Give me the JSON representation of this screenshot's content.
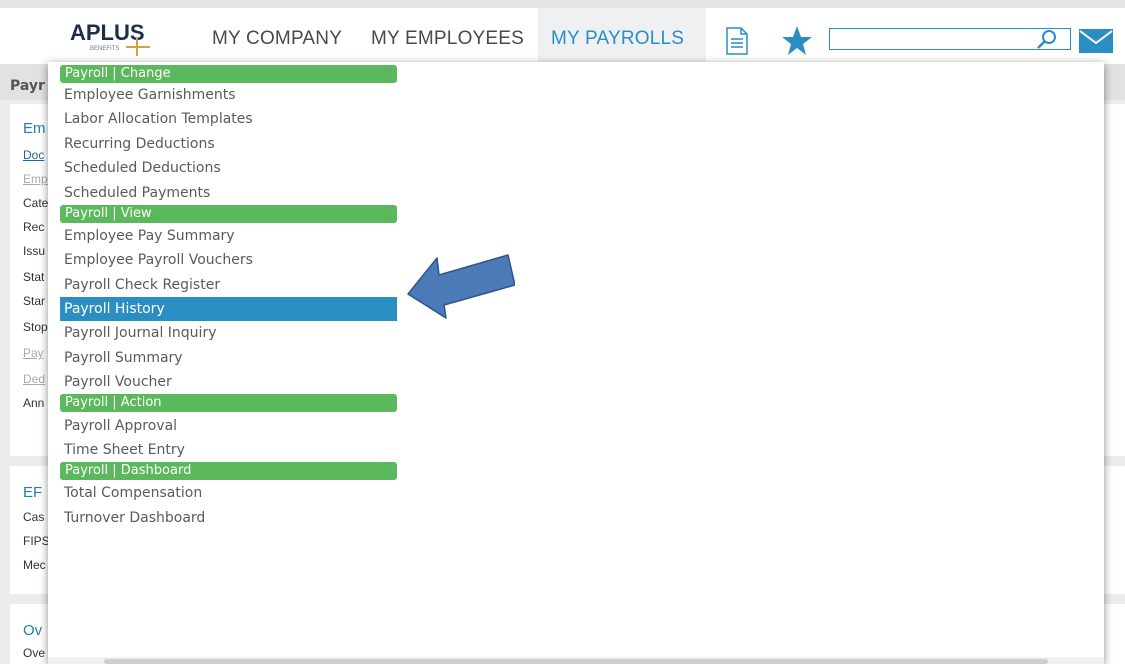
{
  "header": {
    "logo": {
      "main": "APLUS",
      "sub": "BENEFITS"
    },
    "nav": [
      {
        "label": "MY COMPANY",
        "active": false
      },
      {
        "label": "MY EMPLOYEES",
        "active": false
      },
      {
        "label": "MY PAYROLLS",
        "active": true
      }
    ],
    "search": {
      "value": "",
      "placeholder": ""
    }
  },
  "background": {
    "page_title": "Payr",
    "sections": [
      {
        "heading": "Em",
        "links": [
          "Doc",
          "Emp",
          "Cate",
          "Rec",
          "Issu",
          "Stat",
          "Star",
          "Stop",
          "Pay",
          "Ded",
          "Ann"
        ]
      },
      {
        "heading": "EF",
        "links": [
          "Cas",
          "FIPS",
          "Mec"
        ]
      },
      {
        "heading": "Ov",
        "links": [
          "Ove"
        ]
      }
    ]
  },
  "menu": {
    "groups": [
      {
        "header": "Payroll | Change",
        "items": [
          "Employee Garnishments",
          "Labor Allocation Templates",
          "Recurring Deductions",
          "Scheduled Deductions",
          "Scheduled Payments"
        ]
      },
      {
        "header": "Payroll | View",
        "items": [
          "Employee Pay Summary",
          "Employee Payroll Vouchers",
          "Payroll Check Register",
          "Payroll History",
          "Payroll Journal Inquiry",
          "Payroll Summary",
          "Payroll Voucher"
        ]
      },
      {
        "header": "Payroll | Action",
        "items": [
          "Payroll Approval",
          "Time Sheet Entry"
        ]
      },
      {
        "header": "Payroll | Dashboard",
        "items": [
          "Total Compensation",
          "Turnover Dashboard"
        ]
      }
    ],
    "selected_item": "Payroll History"
  },
  "colors": {
    "accent": "#2b8ec2",
    "group_header": "#5cb85c",
    "arrow": "#4a7ab8",
    "logo": "#1f2d4b"
  },
  "icons": [
    "document-icon",
    "star-icon",
    "search-icon",
    "mail-icon",
    "arrow-pointer-icon"
  ]
}
